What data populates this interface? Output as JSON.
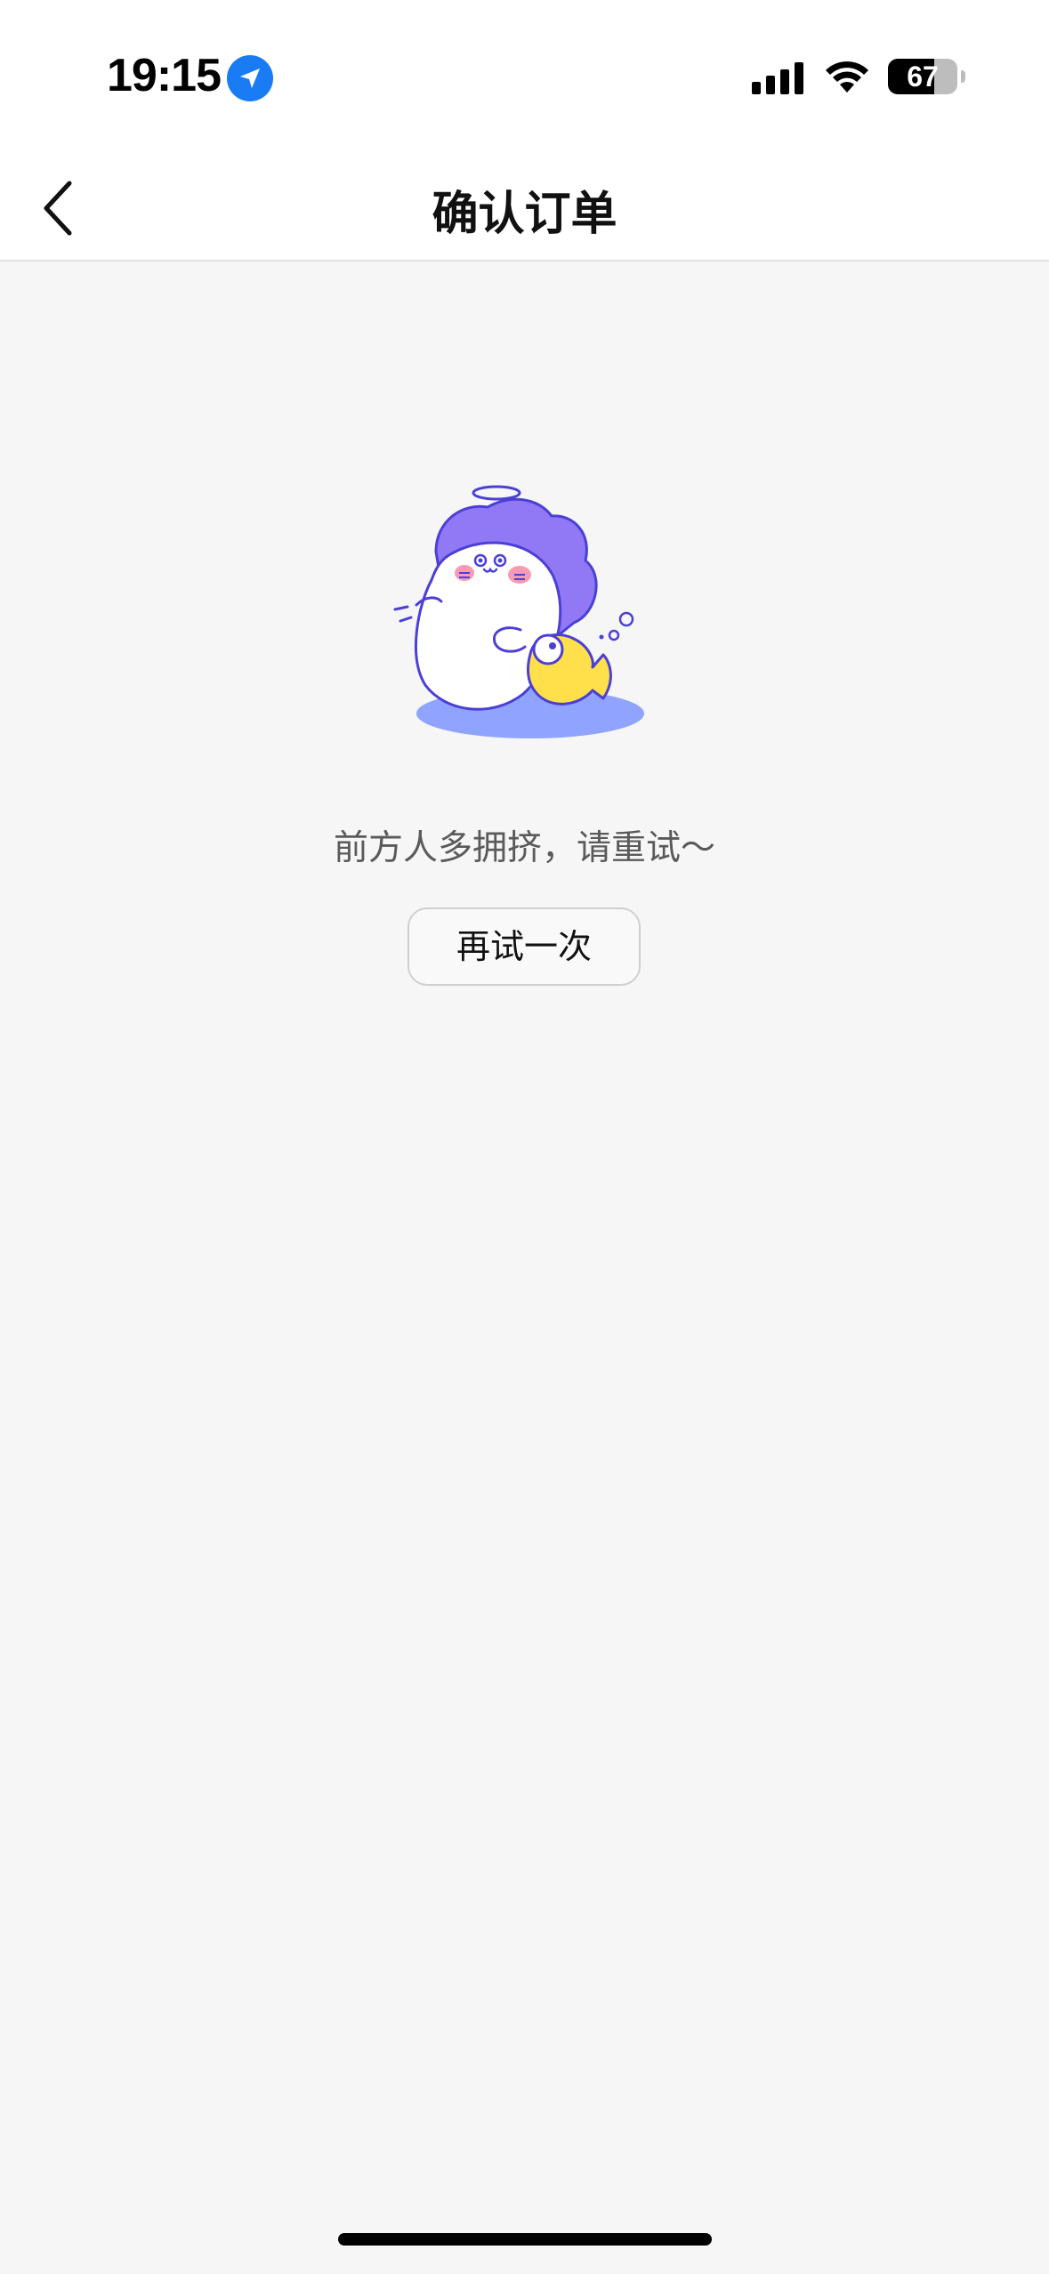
{
  "status_bar": {
    "time": "19:15",
    "battery_level": "67",
    "battery_fraction": 0.67
  },
  "nav": {
    "title": "确认订单",
    "back_icon": "chevron-left-icon"
  },
  "empty_state": {
    "illustration": "crowded-mascot-illustration",
    "message": "前方人多拥挤，请重试～",
    "retry_label": "再试一次"
  },
  "colors": {
    "location_badge": "#1a7cf5",
    "mascot_hair": "#9179f5",
    "mascot_outline": "#4b3fd6",
    "fish": "#ffe04a",
    "shadow": "#8fa3ff",
    "cheek": "#f89ab7"
  }
}
